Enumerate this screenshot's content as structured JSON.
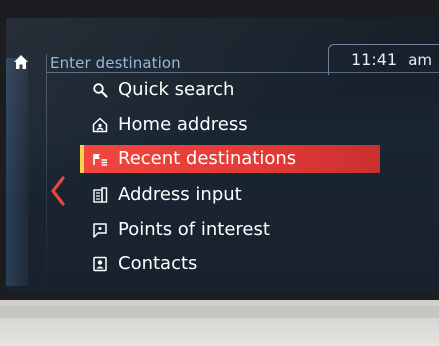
{
  "header": {
    "title": "Enter destination",
    "time": "11:41",
    "ampm": "am"
  },
  "menu": {
    "items": [
      {
        "label": "Quick search",
        "icon": "search-icon"
      },
      {
        "label": "Home address",
        "icon": "home-address-icon"
      },
      {
        "label": "Recent destinations",
        "icon": "recent-destinations-icon",
        "selected": true
      },
      {
        "label": "Address input",
        "icon": "address-input-icon"
      },
      {
        "label": "Points of interest",
        "icon": "points-of-interest-icon"
      },
      {
        "label": "Contacts",
        "icon": "contacts-icon"
      }
    ]
  },
  "colors": {
    "accent": "#e23a36",
    "highlight_edge": "#f6d34a",
    "header_text": "#8fb6d9",
    "screen_bg": "#18222e"
  }
}
